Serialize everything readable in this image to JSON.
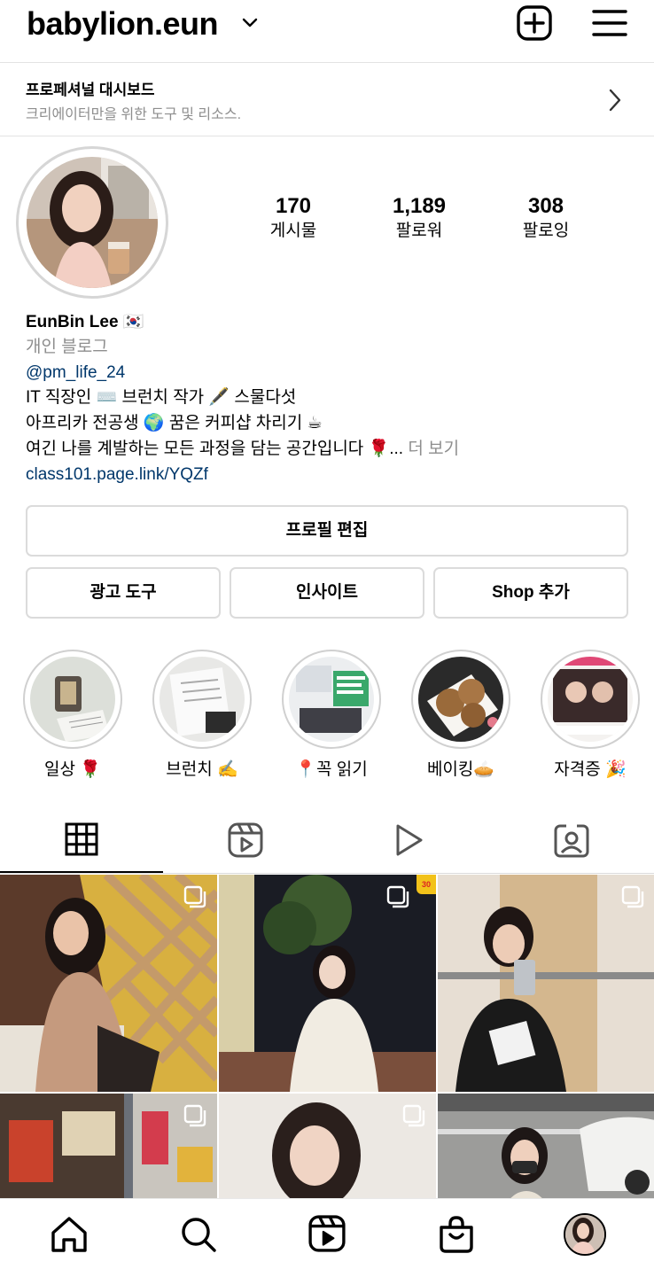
{
  "header": {
    "username": "babylion.eun",
    "icons": [
      "chevron-down-icon",
      "new-post-icon",
      "menu-icon"
    ]
  },
  "dashboard": {
    "title": "프로페셔널 대시보드",
    "subtitle": "크리에이터만을 위한 도구 및 리소스."
  },
  "stats": [
    {
      "value": "170",
      "label": "게시물"
    },
    {
      "value": "1,189",
      "label": "팔로워"
    },
    {
      "value": "308",
      "label": "팔로잉"
    }
  ],
  "bio": {
    "name": "EunBin Lee",
    "name_emoji": "🇰🇷",
    "category": "개인 블로그",
    "tag": "@pm_life_24",
    "line1": "IT 직장인 ⌨️ 브런치 작가 🖋️ 스물다섯",
    "line2": "아프리카 전공생 🌍 꿈은 커피샵 차리기 ☕",
    "line3": "여긴 나를 계발하는 모든 과정을 담는 공간입니다 🌹...",
    "more": "더 보기",
    "link": "class101.page.link/YQZf"
  },
  "buttons": {
    "edit_profile": "프로필 편집",
    "ad_tools": "광고 도구",
    "insights": "인사이트",
    "add_shop": "Shop 추가"
  },
  "highlights": [
    {
      "label": "일상 🌹"
    },
    {
      "label": "브런치 ✍️"
    },
    {
      "label": "📍꼭 읽기"
    },
    {
      "label": "베이킹🥧"
    },
    {
      "label": "자격증 🎉"
    }
  ],
  "tabs": [
    "grid-icon",
    "reels-icon",
    "video-icon",
    "tagged-icon"
  ],
  "grid_badge": "30",
  "bottom_nav": [
    "home-icon",
    "search-icon",
    "reels-icon",
    "shop-icon",
    "profile-avatar"
  ],
  "colors": {
    "link": "#00376b",
    "muted": "#8e8e8e",
    "border": "#dbdbdb"
  }
}
